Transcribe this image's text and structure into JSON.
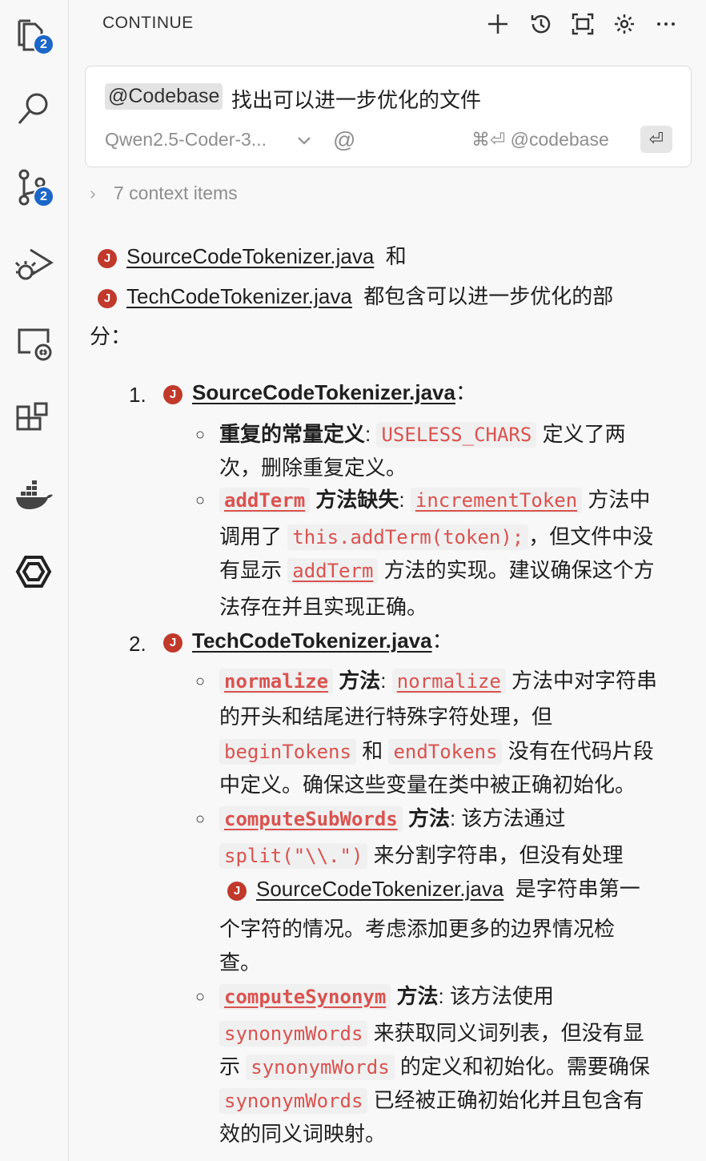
{
  "activity_bar": {
    "explorer_badge": "2",
    "scm_badge": "2"
  },
  "header": {
    "title": "CONTINUE"
  },
  "input": {
    "mention": "@Codebase",
    "prompt": "找出可以进一步优化的文件",
    "model": "Qwen2.5-Coder-3...",
    "at_symbol": "@",
    "shortcut": "⌘⏎ @codebase",
    "enter_symbol": "⏎"
  },
  "context": {
    "label": "7 context items"
  },
  "response": {
    "intro": {
      "file1": "SourceCodeTokenizer.java",
      "and": "和",
      "file2": "TechCodeTokenizer.java",
      "tail": "都包含可以进一步优化的部",
      "tail2": "分："
    },
    "item1": {
      "num": "1.",
      "file": "SourceCodeTokenizer.java",
      "colon": "：",
      "b1": {
        "title": "重复的常量定义",
        "colon": ":",
        "code": "USELESS_CHARS",
        "text1": "定义了两",
        "text2": "次，删除重复定义。"
      },
      "b2": {
        "code1": "addTerm",
        "title": "方法缺失",
        "colon": ":",
        "code2": "incrementToken",
        "text1": "方法中",
        "text2a": "调用了",
        "code3": "this.addTerm(token);",
        "text2b": "，但文件中没",
        "text3a": "有显示",
        "code4": "addTerm",
        "text3b": "方法的实现。建议确保这个方",
        "text4": "法存在并且实现正确。"
      }
    },
    "item2": {
      "num": "2.",
      "file": "TechCodeTokenizer.java",
      "colon": "：",
      "b1": {
        "code1": "normalize",
        "title": "方法",
        "colon": ":",
        "code2": "normalize",
        "text1": "方法中对字符串",
        "text2": "的开头和结尾进行特殊字符处理，但",
        "code3": "beginTokens",
        "and": "和",
        "code4": "endTokens",
        "text3": "没有在代码片段",
        "text4": "中定义。确保这些变量在类中被正确初始化。"
      },
      "b2": {
        "code1": "computeSubWords",
        "title": "方法",
        "text1": ": 该方法通过",
        "code2": "split(\"\\\\.\")",
        "text2": "来分割字符串，但没有处理",
        "file": "SourceCodeTokenizer.java",
        "text3": "是字符串第一",
        "text4": "个字符的情况。考虑添加更多的边界情况检",
        "text5": "查。"
      },
      "b3": {
        "code1": "computeSynonym",
        "title": "方法",
        "text1": ": 该方法使用",
        "code2": "synonymWords",
        "text2": "来获取同义词列表，但没有显",
        "text3a": "示",
        "code3": "synonymWords",
        "text3b": "的定义和初始化。需要确保",
        "code4": "synonymWords",
        "text4": "已经被正确初始化并且包含有",
        "text5": "效的同义词映射。"
      }
    }
  }
}
